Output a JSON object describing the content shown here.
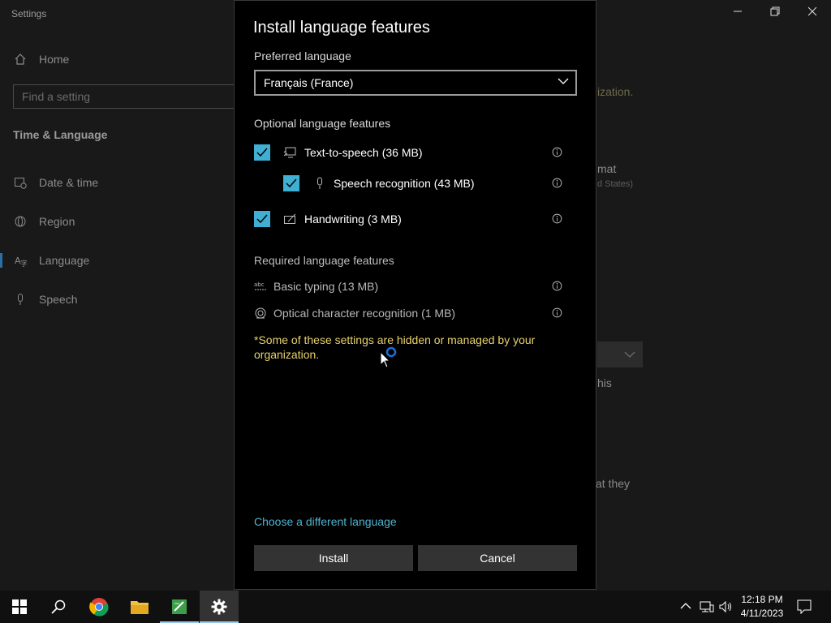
{
  "background": {
    "window_title": "Settings",
    "nav": {
      "home": "Home",
      "search_placeholder": "Find a setting",
      "section": "Time & Language",
      "items": [
        "Date & time",
        "Region",
        "Language",
        "Speech"
      ]
    },
    "right_fragments": {
      "org": "ization.",
      "format": "mat",
      "format_sub": "d States)",
      "this": "his",
      "they": "at they"
    }
  },
  "dialog": {
    "title": "Install language features",
    "preferred_label": "Preferred language",
    "preferred_value": "Français (France)",
    "optional_label": "Optional language features",
    "optional": [
      {
        "label": "Text-to-speech (36 MB)",
        "checked": true
      },
      {
        "label": "Speech recognition (43 MB)",
        "checked": true
      },
      {
        "label": "Handwriting (3 MB)",
        "checked": true
      }
    ],
    "required_label": "Required language features",
    "required": [
      {
        "label": "Basic typing (13 MB)"
      },
      {
        "label": "Optical character recognition (1 MB)"
      }
    ],
    "note": "*Some of these settings are hidden or managed by your organization.",
    "link": "Choose a different language",
    "install": "Install",
    "cancel": "Cancel"
  },
  "taskbar": {
    "time": "12:18 PM",
    "date": "4/11/2023"
  },
  "colors": {
    "accent": "#3fb0d3",
    "link": "#4fb3cf",
    "warning": "#e8d26a"
  }
}
